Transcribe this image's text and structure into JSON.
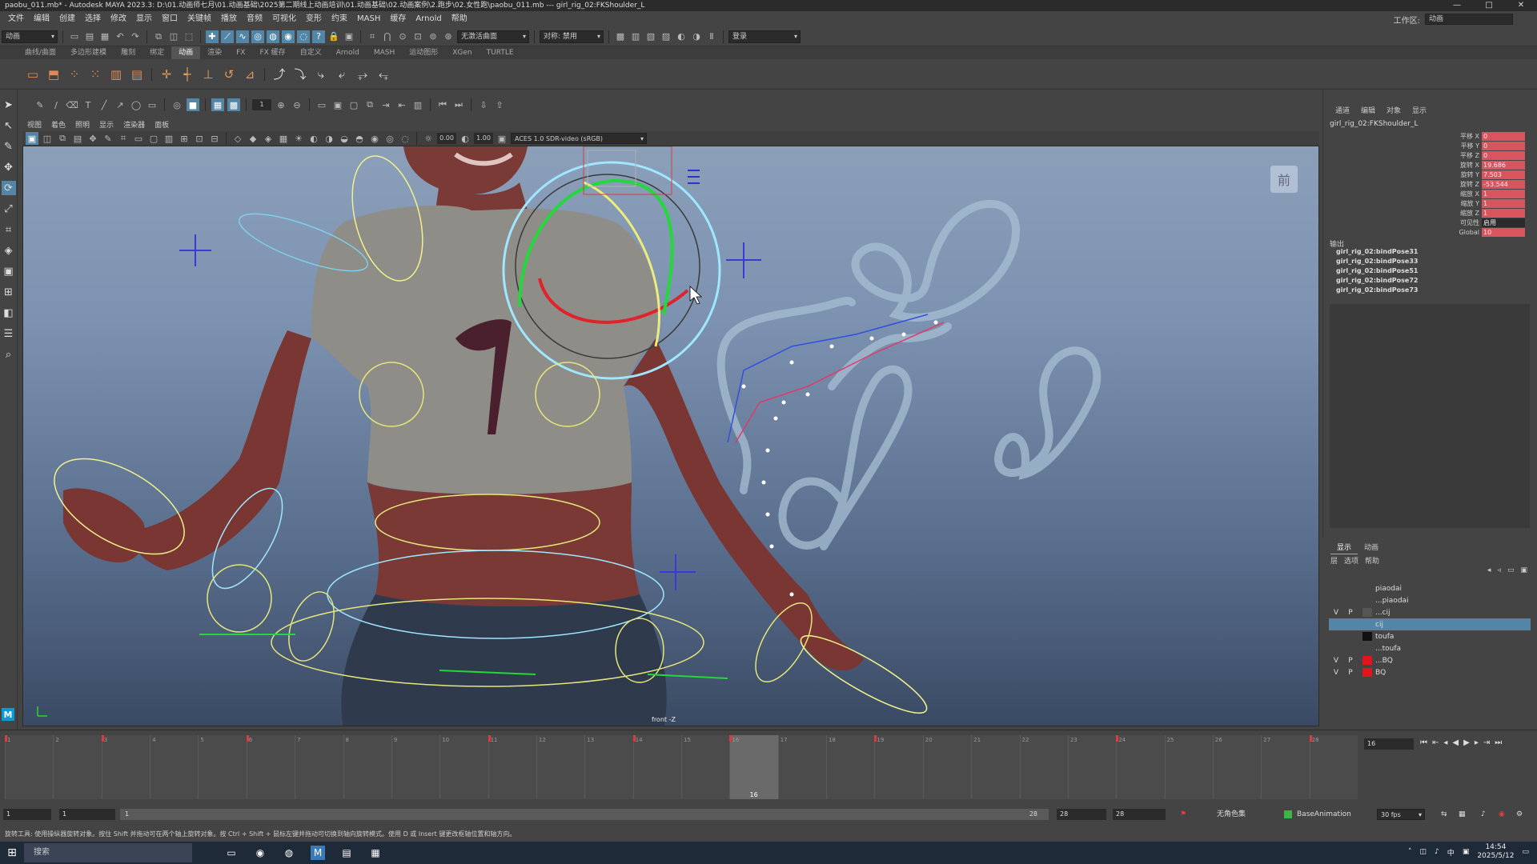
{
  "titlebar": {
    "text": "paobu_011.mb* - Autodesk MAYA 2023.3: D:\\01.动画师七月\\01.动画基础\\2025第二期线上动画培训\\01.动画基础\\02.动画案例\\2.跑步\\02.女性跑\\paobu_011.mb  ---  girl_rig_02:FKShoulder_L",
    "minimize": "—",
    "maximize": "□",
    "close": "✕"
  },
  "menubar": {
    "items": [
      "文件",
      "编辑",
      "创建",
      "选择",
      "修改",
      "显示",
      "窗口",
      "关键帧",
      "播放",
      "音频",
      "可视化",
      "变形",
      "约束",
      "MASH",
      "缓存",
      "Arnold",
      "帮助"
    ],
    "workspace_label": "工作区:",
    "workspace_value": "动画"
  },
  "statusline": {
    "mode": "动画",
    "symmetry": "无激活曲面",
    "symmetry_axis": "对称: 禁用",
    "login": "登录"
  },
  "shelf": {
    "tabs": [
      "曲线/曲面",
      "多边形建模",
      "雕刻",
      "绑定",
      "动画",
      "渲染",
      "FX",
      "FX 缓存",
      "自定义",
      "Arnold",
      "MASH",
      "运动图形",
      "XGen",
      "TURTLE"
    ],
    "active_tab": "动画"
  },
  "toolbar2": {
    "frame_field": "1"
  },
  "panel": {
    "menus": [
      "视图",
      "着色",
      "照明",
      "显示",
      "渲染器",
      "面板"
    ],
    "near_clip": "0.00",
    "far_clip": "1.00",
    "color_space": "ACES 1.0 SDR-video (sRGB)"
  },
  "viewport": {
    "view_cube_label": "前",
    "camera_label": "front -Z"
  },
  "channel_box": {
    "tabs": [
      "通道",
      "编辑",
      "对象",
      "显示"
    ],
    "node": "girl_rig_02:FKShoulder_L",
    "attributes": [
      {
        "label": "平移 X",
        "value": "0",
        "style": "red"
      },
      {
        "label": "平移 Y",
        "value": "0",
        "style": "red"
      },
      {
        "label": "平移 Z",
        "value": "0",
        "style": "red"
      },
      {
        "label": "旋转 X",
        "value": "19.686",
        "style": "red"
      },
      {
        "label": "旋转 Y",
        "value": "7.503",
        "style": "red"
      },
      {
        "label": "旋转 Z",
        "value": "-53.544",
        "style": "red"
      },
      {
        "label": "缩放 X",
        "value": "1",
        "style": "red"
      },
      {
        "label": "缩放 Y",
        "value": "1",
        "style": "red"
      },
      {
        "label": "缩放 Z",
        "value": "1",
        "style": "red"
      },
      {
        "label": "可见性",
        "value": "启用",
        "style": "plain"
      },
      {
        "label": "Global",
        "value": "10",
        "style": "red"
      }
    ],
    "outputs_label": "输出",
    "outputs": [
      "girl_rig_02:bindPose31",
      "girl_rig_02:bindPose33",
      "girl_rig_02:bindPose51",
      "girl_rig_02:bindPose72",
      "girl_rig_02:bindPose73"
    ]
  },
  "layers": {
    "tabs": [
      "显示",
      "动画"
    ],
    "menu": [
      "层",
      "选项",
      "帮助"
    ],
    "rows": [
      {
        "v": "",
        "p": "",
        "swatch": "",
        "name": "piaodai"
      },
      {
        "v": "",
        "p": "",
        "swatch": "",
        "name": "...piaodai"
      },
      {
        "v": "V",
        "p": "P",
        "swatch": "#555555",
        "name": "...cij"
      },
      {
        "v": "",
        "p": "",
        "swatch": "",
        "name": "cij",
        "selected": true
      },
      {
        "v": "",
        "p": "",
        "swatch": "#111111",
        "name": "toufa"
      },
      {
        "v": "",
        "p": "",
        "swatch": "",
        "name": "...toufa"
      },
      {
        "v": "V",
        "p": "P",
        "swatch": "#e0161d",
        "name": "...BQ"
      },
      {
        "v": "V",
        "p": "P",
        "swatch": "#e0161d",
        "name": "BQ"
      }
    ]
  },
  "timeslider": {
    "ticks": [
      "1",
      "2",
      "3",
      "4",
      "5",
      "6",
      "7",
      "8",
      "9",
      "10",
      "11",
      "12",
      "13",
      "14",
      "15",
      "16",
      "17",
      "18",
      "19",
      "20",
      "21",
      "22",
      "23",
      "24",
      "25",
      "26",
      "27",
      "28"
    ],
    "keys": [
      1,
      3,
      6,
      11,
      14,
      16,
      19,
      24,
      28
    ],
    "current_frame": "16",
    "current_frame_field": "16"
  },
  "rangebar": {
    "start": "1",
    "anim_start": "1",
    "slider_start": "1",
    "slider_end": "28",
    "anim_end": "28",
    "end": "28",
    "char_set": "无角色集",
    "anim_layer": "BaseAnimation",
    "fps": "30 fps"
  },
  "helpline": {
    "text": "旋转工具: 使用操纵器旋转对象。按住 Shift 并拖动可在两个轴上旋转对象。按 Ctrl + Shift + 鼠标左键并拖动可切换到轴向旋转模式。使用 D 或 Insert 键更改枢轴位置和轴方向。"
  },
  "taskbar": {
    "search": "搜索",
    "time": "14:54",
    "date": "2025/5/12"
  }
}
